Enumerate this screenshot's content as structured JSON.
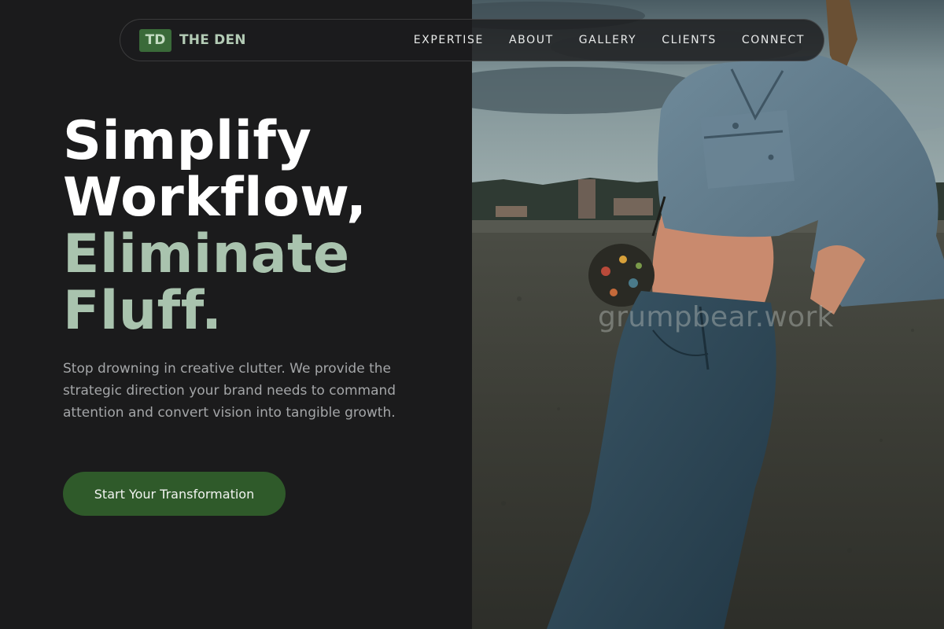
{
  "brand": {
    "mark": "TD",
    "name": "THE DEN"
  },
  "nav": {
    "items": [
      {
        "label": "EXPERTISE"
      },
      {
        "label": "ABOUT"
      },
      {
        "label": "GALLERY"
      },
      {
        "label": "CLIENTS"
      },
      {
        "label": "CONNECT"
      }
    ]
  },
  "hero": {
    "headline_line1": "Simplify",
    "headline_line2": "Workflow,",
    "headline_line3": "Eliminate",
    "headline_line4": "Fluff.",
    "subcopy": "Stop drowning in creative clutter. We provide the strategic direction your brand needs to command attention and convert vision into tangible growth.",
    "cta_label": "Start Your Transformation",
    "watermark": "grumpbear.work"
  },
  "colors": {
    "background": "#1b1b1c",
    "accent_green": "#2f5a2a",
    "sage": "#a9c3ae",
    "brand_mark_bg": "#3a6a39"
  }
}
